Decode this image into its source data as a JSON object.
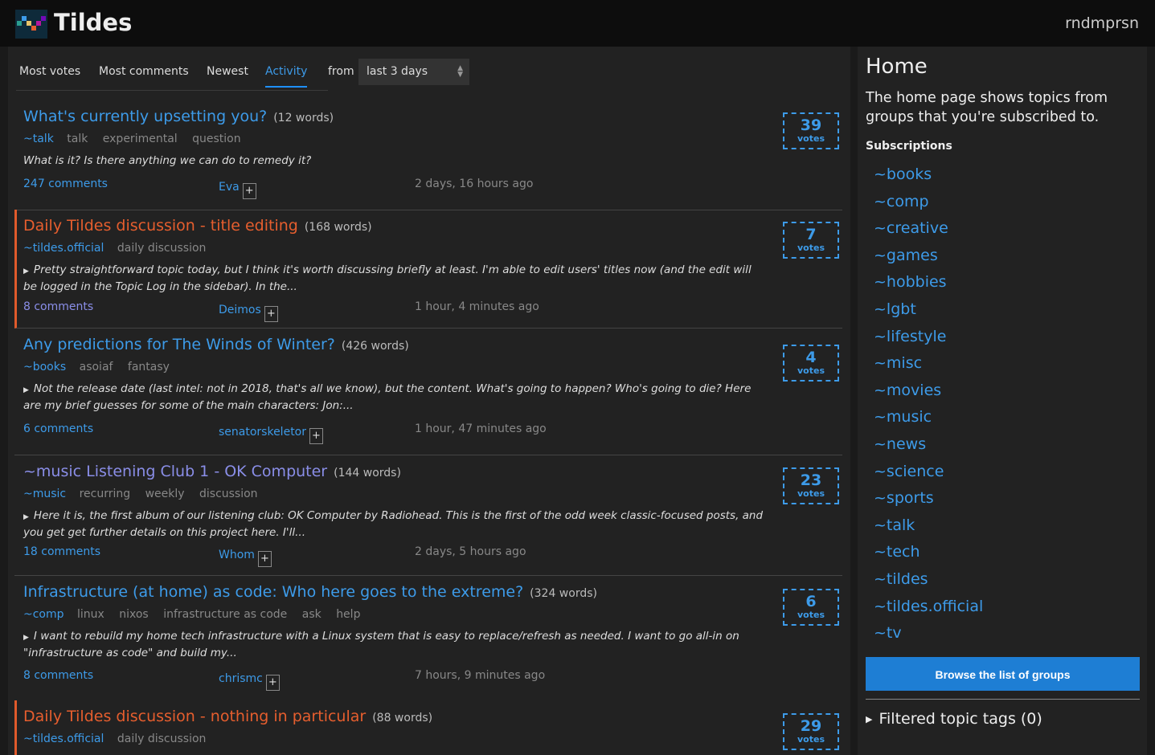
{
  "header": {
    "site_title": "Tildes",
    "username": "rndmprsn"
  },
  "listing": {
    "options": [
      "Most votes",
      "Most comments",
      "Newest",
      "Activity"
    ],
    "active": "Activity",
    "from_label": "from",
    "period": "last 3 days"
  },
  "topics": [
    {
      "title": "What's currently upsetting you?",
      "words": "(12 words)",
      "group": "~talk",
      "tags": [
        "talk",
        "experimental",
        "question"
      ],
      "text": "What is it? Is there anything we can do to remedy it?",
      "comments": "247 comments",
      "user": "Eva",
      "time": "2 days, 16 hours ago",
      "votes": "39",
      "votes_label": "votes"
    },
    {
      "title": "Daily Tildes discussion - title editing",
      "words": "(168 words)",
      "group": "~tildes.official",
      "tags": [
        "daily discussion"
      ],
      "text": "Pretty straightforward topic today, but I think it's worth discussing briefly at least. I'm able to edit users' titles now (and the edit will be logged in the Topic Log in the sidebar). In the...",
      "comments": "8 comments",
      "user": "Deimos",
      "time": "1 hour, 4 minutes ago",
      "votes": "7",
      "votes_label": "votes"
    },
    {
      "title": "Any predictions for The Winds of Winter?",
      "words": "(426 words)",
      "group": "~books",
      "tags": [
        "asoiaf",
        "fantasy"
      ],
      "text": "Not the release date (last intel: not in 2018, that's all we know), but the content. What's going to happen? Who's going to die? Here are my brief guesses for some of the main characters: Jon:...",
      "comments": "6 comments",
      "user": "senatorskeletor",
      "time": "1 hour, 47 minutes ago",
      "votes": "4",
      "votes_label": "votes"
    },
    {
      "title": "~music Listening Club 1 - OK Computer",
      "words": "(144 words)",
      "group": "~music",
      "tags": [
        "recurring",
        "weekly",
        "discussion"
      ],
      "text": "Here it is, the first album of our listening club: OK Computer by Radiohead. This is the first of the odd week classic-focused posts, and you get get further details on this project here. I'll...",
      "comments": "18 comments",
      "user": "Whom",
      "time": "2 days, 5 hours ago",
      "votes": "23",
      "votes_label": "votes"
    },
    {
      "title": "Infrastructure (at home) as code: Who here goes to the extreme?",
      "words": "(324 words)",
      "group": "~comp",
      "tags": [
        "linux",
        "nixos",
        "infrastructure as code",
        "ask",
        "help"
      ],
      "text": "I want to rebuild my home tech infrastructure with a Linux system that is easy to replace/refresh as needed. I want to go all-in on \"infrastructure as code\" and build my...",
      "comments": "8 comments",
      "user": "chrismc",
      "time": "7 hours, 9 minutes ago",
      "votes": "6",
      "votes_label": "votes"
    },
    {
      "title": "Daily Tildes discussion - nothing in particular",
      "words": "(88 words)",
      "group": "~tildes.official",
      "tags": [
        "daily discussion"
      ],
      "text": "",
      "comments": "",
      "user": "",
      "time": "",
      "votes": "29",
      "votes_label": "votes"
    }
  ],
  "sidebar": {
    "title": "Home",
    "description": "The home page shows topics from groups that you're subscribed to.",
    "subscriptions_label": "Subscriptions",
    "subscriptions": [
      "~books",
      "~comp",
      "~creative",
      "~games",
      "~hobbies",
      "~lgbt",
      "~lifestyle",
      "~misc",
      "~movies",
      "~music",
      "~news",
      "~science",
      "~sports",
      "~talk",
      "~tech",
      "~tildes",
      "~tildes.official",
      "~tv"
    ],
    "browse_button": "Browse the list of groups",
    "filtered_tags": "Filtered topic tags (0)"
  },
  "colors": {
    "accent": "#3d9be9",
    "official": "#e65e2e",
    "visited": "#8a8ee8",
    "button": "#1e7ed4"
  }
}
